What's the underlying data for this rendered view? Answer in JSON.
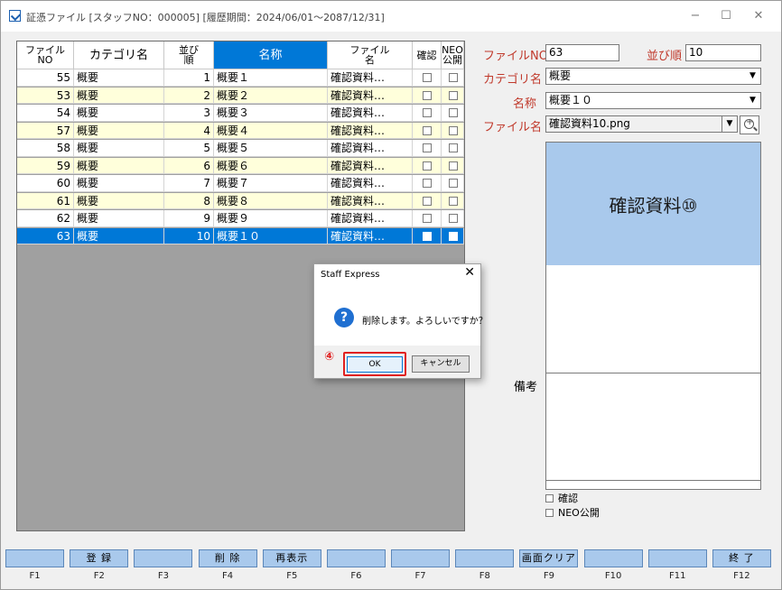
{
  "window": {
    "title": "証憑ファイル [スタッフNO：000005] [履歴期間：2024/06/01～2087/12/31]",
    "controls": [
      "−",
      "☐",
      "✕"
    ]
  },
  "grid": {
    "headers": [
      "ファイル\nNO",
      "カテゴリ名",
      "並び\n順",
      "名称",
      "ファイル\n名",
      "確認",
      "NEO\n公開"
    ],
    "rows": [
      {
        "no": "55",
        "category": "概要",
        "order": "1",
        "name": "概要１",
        "file": "確認資料…",
        "checked": false,
        "neo": false
      },
      {
        "no": "53",
        "category": "概要",
        "order": "2",
        "name": "概要２",
        "file": "確認資料…",
        "checked": false,
        "neo": false
      },
      {
        "no": "54",
        "category": "概要",
        "order": "3",
        "name": "概要３",
        "file": "確認資料…",
        "checked": false,
        "neo": false
      },
      {
        "no": "57",
        "category": "概要",
        "order": "4",
        "name": "概要４",
        "file": "確認資料…",
        "checked": false,
        "neo": false
      },
      {
        "no": "58",
        "category": "概要",
        "order": "5",
        "name": "概要５",
        "file": "確認資料…",
        "checked": false,
        "neo": false
      },
      {
        "no": "59",
        "category": "概要",
        "order": "6",
        "name": "概要６",
        "file": "確認資料…",
        "checked": false,
        "neo": false
      },
      {
        "no": "60",
        "category": "概要",
        "order": "7",
        "name": "概要７",
        "file": "確認資料…",
        "checked": false,
        "neo": false
      },
      {
        "no": "61",
        "category": "概要",
        "order": "8",
        "name": "概要８",
        "file": "確認資料…",
        "checked": false,
        "neo": false
      },
      {
        "no": "62",
        "category": "概要",
        "order": "9",
        "name": "概要９",
        "file": "確認資料…",
        "checked": false,
        "neo": false
      },
      {
        "no": "63",
        "category": "概要",
        "order": "10",
        "name": "概要１０",
        "file": "確認資料…",
        "checked": false,
        "neo": false
      }
    ],
    "selected_index": 9
  },
  "form": {
    "file_no_label": "ファイルNO",
    "file_no_value": "63",
    "order_label": "並び順",
    "order_value": "10",
    "category_label": "カテゴリ名",
    "category_value": "概要",
    "name_label": "名称",
    "name_value": "概要１０",
    "filename_label": "ファイル名",
    "filename_value": "確認資料10.png",
    "preview_text": "確認資料⑩",
    "memo_label": "備考",
    "confirm_label": "確認",
    "neo_label": "NEO公開"
  },
  "fkeys": [
    {
      "key": "F1",
      "label": ""
    },
    {
      "key": "F2",
      "label": "登 録"
    },
    {
      "key": "F3",
      "label": ""
    },
    {
      "key": "F4",
      "label": "削 除"
    },
    {
      "key": "F5",
      "label": "再表示"
    },
    {
      "key": "F6",
      "label": ""
    },
    {
      "key": "F7",
      "label": ""
    },
    {
      "key": "F8",
      "label": ""
    },
    {
      "key": "F9",
      "label": "画面クリア"
    },
    {
      "key": "F10",
      "label": ""
    },
    {
      "key": "F11",
      "label": ""
    },
    {
      "key": "F12",
      "label": "終 了"
    }
  ],
  "dialog": {
    "title": "Staff Express",
    "message": "削除します。よろしいですか？",
    "ok": "OK",
    "cancel": "キャンセル",
    "step_marker": "④"
  },
  "colors": {
    "accent": "#0078d7",
    "even_row": "#ffffdb",
    "label_red": "#c0392b",
    "fkey_blue": "#a9c9ec",
    "highlight": "#e02020"
  }
}
